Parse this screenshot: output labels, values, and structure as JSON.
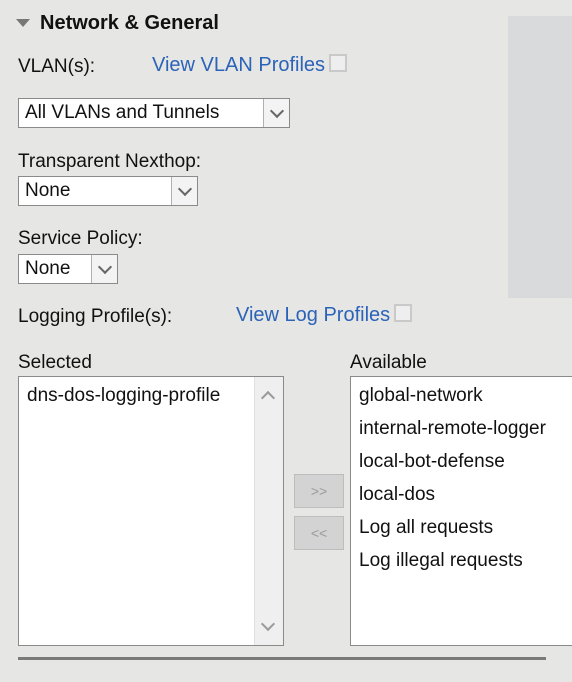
{
  "section": {
    "title": "Network & General"
  },
  "vlans": {
    "label": "VLAN(s):",
    "link": "View VLAN Profiles",
    "selected": "All VLANs and Tunnels"
  },
  "transparent_nexthop": {
    "label": "Transparent Nexthop:",
    "selected": "None"
  },
  "service_policy": {
    "label": "Service Policy:",
    "selected": "None"
  },
  "logging": {
    "label": "Logging Profile(s):",
    "link": "View Log Profiles",
    "selected_header": "Selected",
    "available_header": "Available",
    "selected_items": [
      "dns-dos-logging-profile"
    ],
    "available_items": [
      "global-network",
      "internal-remote-logger",
      "local-bot-defense",
      "local-dos",
      "Log all requests",
      "Log illegal requests"
    ],
    "add_label": ">>",
    "remove_label": "<<"
  },
  "icons": {
    "collapse": "triangle-down-icon",
    "external": "external-link-icon",
    "dropdown": "chevron-down-icon"
  },
  "colors": {
    "link": "#2b63b8",
    "background": "#e6e6e4"
  }
}
